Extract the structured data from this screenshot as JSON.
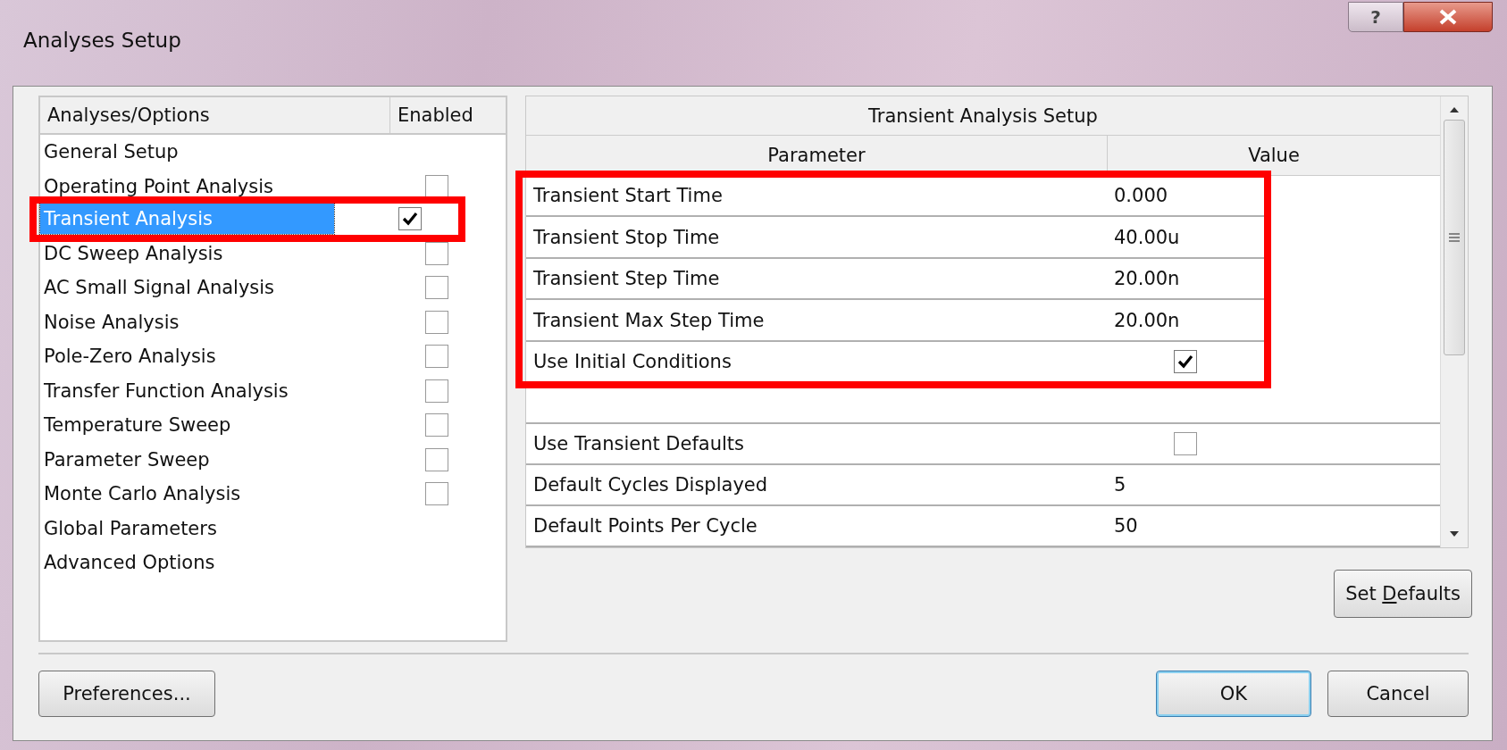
{
  "window": {
    "title": "Analyses Setup",
    "help_button": "?"
  },
  "analyses_list": {
    "columns": [
      "Analyses/Options",
      "Enabled"
    ],
    "items": [
      {
        "label": "General Setup",
        "kind": "section",
        "selected": false,
        "highlighted": false
      },
      {
        "label": "Operating Point Analysis",
        "kind": "analysis",
        "checked": false,
        "selected": false,
        "highlighted": false
      },
      {
        "label": "Transient Analysis",
        "kind": "analysis",
        "checked": true,
        "selected": true,
        "highlighted": true
      },
      {
        "label": "DC Sweep Analysis",
        "kind": "analysis",
        "checked": false,
        "selected": false,
        "highlighted": false
      },
      {
        "label": "AC Small Signal Analysis",
        "kind": "analysis",
        "checked": false,
        "selected": false,
        "highlighted": false
      },
      {
        "label": "Noise Analysis",
        "kind": "analysis",
        "checked": false,
        "selected": false,
        "highlighted": false
      },
      {
        "label": "Pole-Zero Analysis",
        "kind": "analysis",
        "checked": false,
        "selected": false,
        "highlighted": false
      },
      {
        "label": "Transfer Function Analysis",
        "kind": "analysis",
        "checked": false,
        "selected": false,
        "highlighted": false
      },
      {
        "label": "Temperature Sweep",
        "kind": "analysis",
        "checked": false,
        "selected": false,
        "highlighted": false
      },
      {
        "label": "Parameter Sweep",
        "kind": "analysis",
        "checked": false,
        "selected": false,
        "highlighted": false
      },
      {
        "label": "Monte Carlo Analysis",
        "kind": "analysis",
        "checked": false,
        "selected": false,
        "highlighted": false
      },
      {
        "label": "Global Parameters",
        "kind": "section",
        "selected": false,
        "highlighted": false
      },
      {
        "label": "Advanced Options",
        "kind": "section",
        "selected": false,
        "highlighted": false
      }
    ]
  },
  "setup_table": {
    "title": "Transient Analysis Setup",
    "columns": [
      "Parameter",
      "Value"
    ],
    "rows": [
      {
        "kind": "value",
        "parameter": "Transient Start Time",
        "value": "0.000",
        "highlighted": true
      },
      {
        "kind": "value",
        "parameter": "Transient Stop Time",
        "value": "40.00u",
        "highlighted": true
      },
      {
        "kind": "value",
        "parameter": "Transient Step Time",
        "value": "20.00n",
        "highlighted": true
      },
      {
        "kind": "value",
        "parameter": "Transient Max Step Time",
        "value": "20.00n",
        "highlighted": true
      },
      {
        "kind": "checkbox",
        "parameter": "Use Initial Conditions",
        "checked": true,
        "highlighted": true
      },
      {
        "kind": "blank",
        "highlighted": false
      },
      {
        "kind": "checkbox",
        "parameter": "Use Transient Defaults",
        "checked": false,
        "highlighted": false
      },
      {
        "kind": "value",
        "parameter": "Default Cycles Displayed",
        "value": "5",
        "highlighted": false
      },
      {
        "kind": "value",
        "parameter": "Default Points Per Cycle",
        "value": "50",
        "highlighted": false
      }
    ]
  },
  "set_defaults_button": {
    "label_parts": [
      "Set ",
      "D",
      "efaults"
    ]
  },
  "buttons": [
    {
      "label": "Preferences...",
      "kind": "left",
      "default": false
    },
    {
      "label": "OK",
      "kind": "right",
      "default": true
    },
    {
      "label": "Cancel",
      "kind": "right",
      "default": false
    }
  ]
}
